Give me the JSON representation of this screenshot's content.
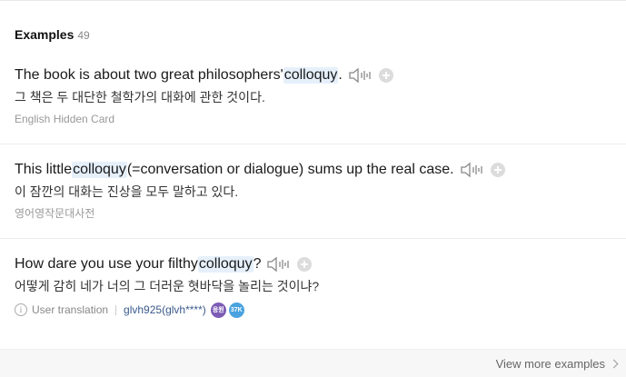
{
  "section": {
    "title": "Examples",
    "count": "49"
  },
  "examples": [
    {
      "before": "The book is about two great philosophers' ",
      "keyword": "colloquy",
      "after": ".",
      "translation": "그 책은 두 대단한 철학가의 대화에 관한 것이다.",
      "source": "English Hidden Card"
    },
    {
      "before": "This little ",
      "keyword": "colloquy",
      "after": "(=conversation or dialogue) sums up the real case.",
      "translation": "이 잠깐의 대화는 진상을 모두 말하고 있다.",
      "source": "영어영작문대사전"
    },
    {
      "before": "How dare you use your filthy ",
      "keyword": "colloquy",
      "after": "?",
      "translation": "어떻게 감히 네가 너의 그 더러운 혓바닥을 놀리는 것이냐?",
      "user_translation_label": "User translation",
      "user": "glvh925(glvh****)",
      "badges": [
        "응원",
        "37K"
      ]
    }
  ],
  "footer": {
    "more_label": "View more examples"
  },
  "icons": [
    "speaker-icon",
    "add-icon",
    "info-icon",
    "chevron-right-icon"
  ]
}
